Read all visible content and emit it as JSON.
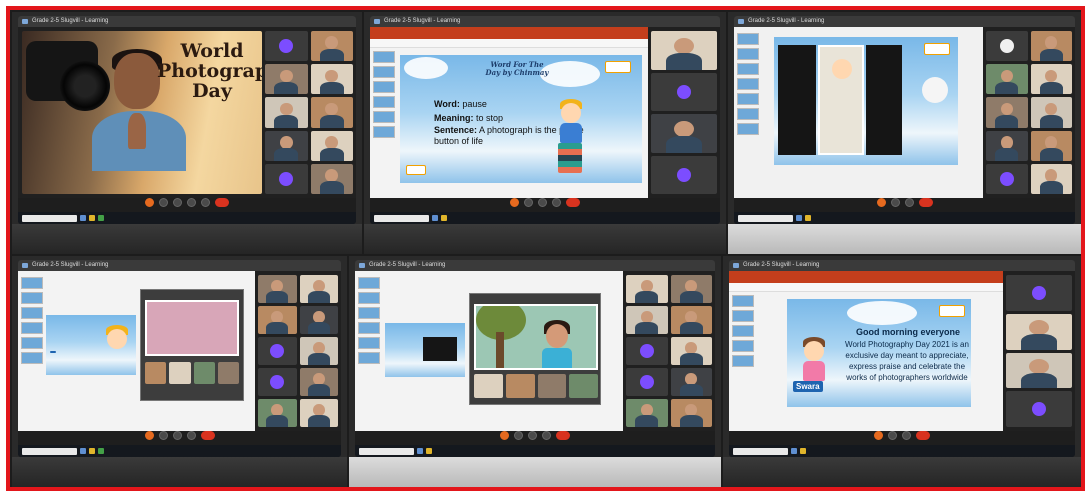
{
  "collage": {
    "border_color": "#e3161b"
  },
  "tiles": [
    {
      "app_window": "Grade 2-5 Slugvill - Learning",
      "slide_title": "World Photography Day",
      "meeting_label": "Grade 2 Assembly & Telugu"
    },
    {
      "app_window": "Grade 2-5 Slugvill - Learning",
      "slide_heading": "Word For The Day by Chinmay",
      "word_label": "Word:",
      "word_value": "pause",
      "meaning_label": "Meaning:",
      "meaning_value": "to stop",
      "sentence_label": "Sentence:",
      "sentence_value": "A photograph is the pause button of life",
      "meeting_label": "Grade 2 Assembly & Telugu"
    },
    {
      "app_window": "Grade 2-5 Slugvill - Learning",
      "meeting_label": "Grade 2 Assembly & Telugu"
    },
    {
      "app_window": "Grade 2-5 Slugvill - Learning",
      "meeting_label": "Grade 2 Assembly & Telugu"
    },
    {
      "app_window": "Grade 2-5 Slugvill - Learning",
      "meeting_label": "Grade 2 Assembly & Telugu"
    },
    {
      "app_window": "Grade 2-5 Slugvill - Learning",
      "greeting": "Good morning everyone",
      "body": "World Photography Day 2021 is an exclusive day meant to appreciate, express praise and celebrate the works of photographers worldwide",
      "name_tag": "Swara",
      "meeting_label": "Grade 2 Assembly & Telugu"
    }
  ]
}
